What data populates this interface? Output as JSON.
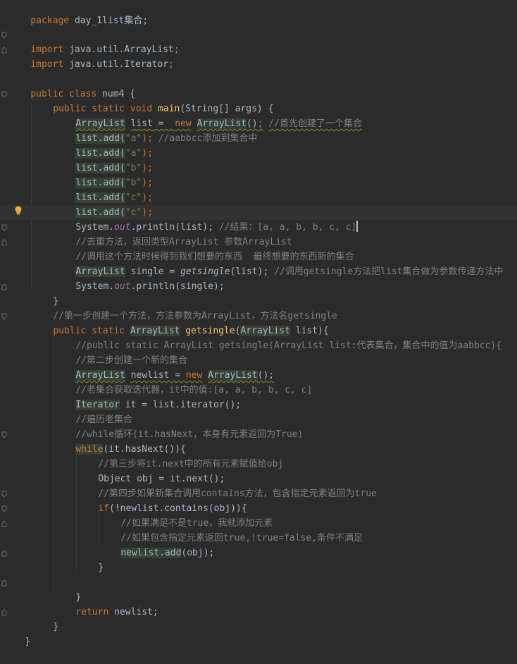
{
  "code": {
    "package_kw": "package",
    "package_name": "day_1list集合;",
    "import_kw": "import",
    "import1": "java.util.ArrayList",
    "import2": "java.util.Iterator",
    "public": "public",
    "class": "class",
    "static": "static",
    "void": "void",
    "new": "new",
    "return": "return",
    "while": "while",
    "if": "if",
    "class_name": "num4",
    "main": "main",
    "main_params": "(String[] args) {",
    "arraylist": "ArrayList",
    "list_decl_var": "list",
    "cmt_create_set": "//首先创建了一个集合",
    "list_add": "list.add(",
    "str_a": "\"a\"",
    "str_b": "\"b\"",
    "str_c": "\"c\"",
    "close_stmt": ");",
    "cmt_aabbcc": "//aabbcc添加到集合中",
    "system": "System.",
    "out": "out",
    "println_list": ".println(list);",
    "cmt_result": "//结果：[a, a, b, b, c, c]",
    "cmt_dedupe": "//去重方法，返回类型ArrayList 参数ArrayList",
    "cmt_call": "//调用这个方法时候得到我们想要的东西  最终想要的东西新的集合",
    "single_decl": "single = ",
    "getsingle": "getsingle",
    "getsingle_call_args": "(list);",
    "cmt_call_getsingle": "//调用getsingle方法把list集合做为参数传递方法中",
    "println_single": ".println(single);",
    "close_brace": "}",
    "cmt_step1": "//第一步创建一个方法，方法参数为ArrayList，方法名getsingle",
    "getsingle_params": "list){",
    "cmt_public_sig": "//public static ArrayList getsingle(ArrayList list:代表集合，集合中的值为aabbcc){",
    "cmt_step2": "//第二步创建一个新的集合",
    "newlist_decl": "newlist = ",
    "newlist_ctor_end": "();",
    "cmt_iterator": "//老集合获取迭代器，it中的值:[a, a, b, b, c, c]",
    "iterator_type": "Iterator",
    "iterator_decl": " it = list.iterator();",
    "cmt_traverse": "//遍历老集合",
    "cmt_while": "//while循环(it.hasNext，本身有元素返回为True)",
    "while_cond": "(it.hasNext()){",
    "cmt_step3": "//第三步将it.next中的所有元素赋值给obj",
    "obj_decl": "Object obj = it.next();",
    "cmt_step4": "//第四步如果新集合调用contains方法，包含指定元素返回为true",
    "if_cond": "(!newlist.contains(obj)){",
    "cmt_if_true": "//如果满足不是true，我就添加元素",
    "cmt_if_contains": "//如果包含指定元素返回true,!true=false,条件不满足",
    "newlist_add": "newlist.add",
    "newlist_add_args": "(obj);",
    "return_stmt": "newlist;"
  }
}
